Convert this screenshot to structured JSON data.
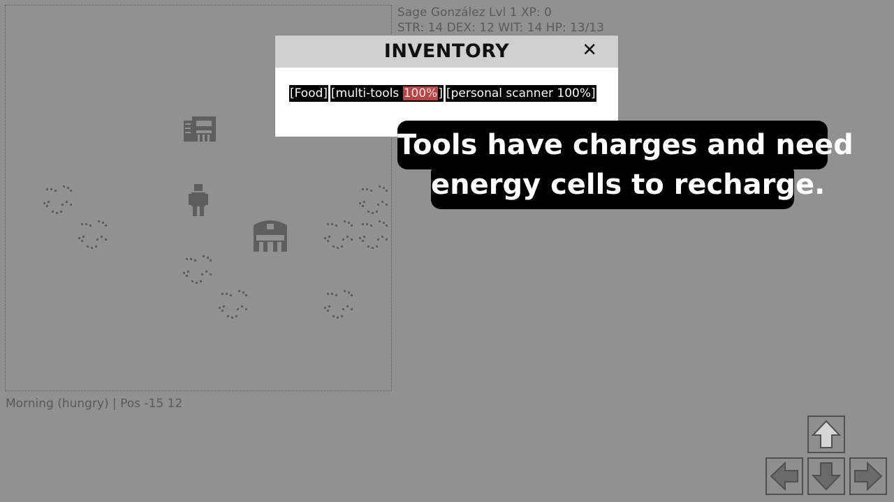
{
  "player": {
    "line1": "Sage González Lvl 1 XP: 0",
    "line2": "STR: 14 DEX: 12 WIT: 14 HP: 13/13"
  },
  "status": {
    "text": "Morning (hungry) | Pos -15 12"
  },
  "inventory": {
    "title": "INVENTORY",
    "close": "✕",
    "items": [
      {
        "label": "[Food]"
      },
      {
        "prefix": "[multi-tools ",
        "charge": "100%",
        "suffix": "]"
      },
      {
        "label": "[personal scanner 100%]"
      }
    ]
  },
  "tooltip": {
    "line1": "Tools have charges and need",
    "line2": "energy cells to recharge."
  },
  "colors": {
    "background": "#919191",
    "sprite": "#5e5e5e",
    "charge_highlight": "#b34747"
  },
  "icons": {
    "building": "building-icon",
    "player": "player-icon",
    "fight": "fight-arena-icon",
    "grass": "grass-icon",
    "arrows": [
      "arrow-up-icon",
      "arrow-left-icon",
      "arrow-down-icon",
      "arrow-right-icon"
    ]
  }
}
